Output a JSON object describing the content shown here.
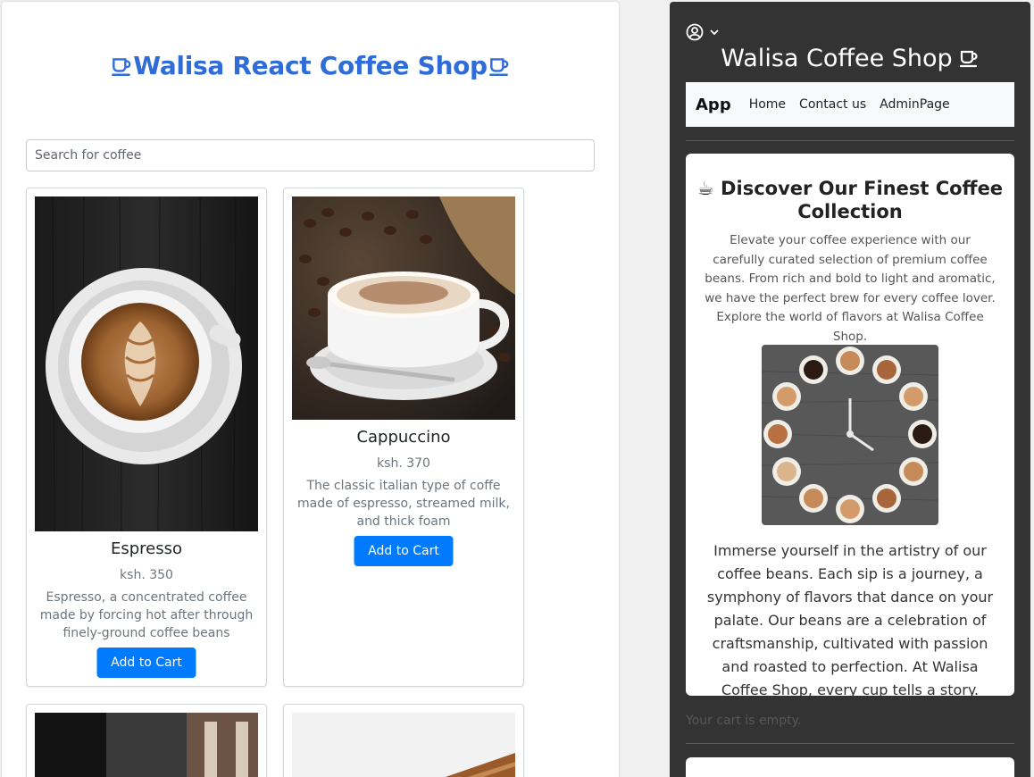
{
  "left": {
    "title": "Walisa React Coffee Shop",
    "search": {
      "placeholder": "Search for coffee",
      "value": ""
    },
    "products": [
      {
        "name": "Espresso",
        "price": "ksh. 350",
        "description": "Espresso, a concentrated coffee made by forcing hot after through finely-ground coffee beans",
        "button_label": "Add to Cart"
      },
      {
        "name": "Cappuccino",
        "price": "ksh. 370",
        "description": "The classic italian type of coffe made of espresso, streamed milk, and thick foam",
        "button_label": "Add to Cart"
      }
    ]
  },
  "right": {
    "title": "Walisa Coffee Shop",
    "navbar": {
      "brand": "App",
      "links": [
        "Home",
        "Contact us",
        "AdminPage"
      ]
    },
    "promo": {
      "title": "☕ Discover Our Finest Coffee Collection",
      "description": "Elevate your coffee experience with our carefully curated selection of premium coffee beans. From rich and bold to light and aromatic, we have the perfect brew for every coffee lover. Explore the world of flavors at Walisa Coffee Shop.",
      "body": "Immerse yourself in the artistry of our coffee beans. Each sip is a journey, a symphony of flavors that dance on your palate. Our beans are a celebration of craftsmanship, cultivated with passion and roasted to perfection. At Walisa Coffee Shop, every cup tells a story."
    },
    "cart_status": "Your cart is empty."
  },
  "icons": {
    "title_cup": "cup-icon",
    "user": "user-circle-icon",
    "chevron": "chevron-down-icon"
  },
  "colors": {
    "accent": "#007bff",
    "title_blue": "#2f6cd8",
    "dark_panel": "#333333"
  }
}
